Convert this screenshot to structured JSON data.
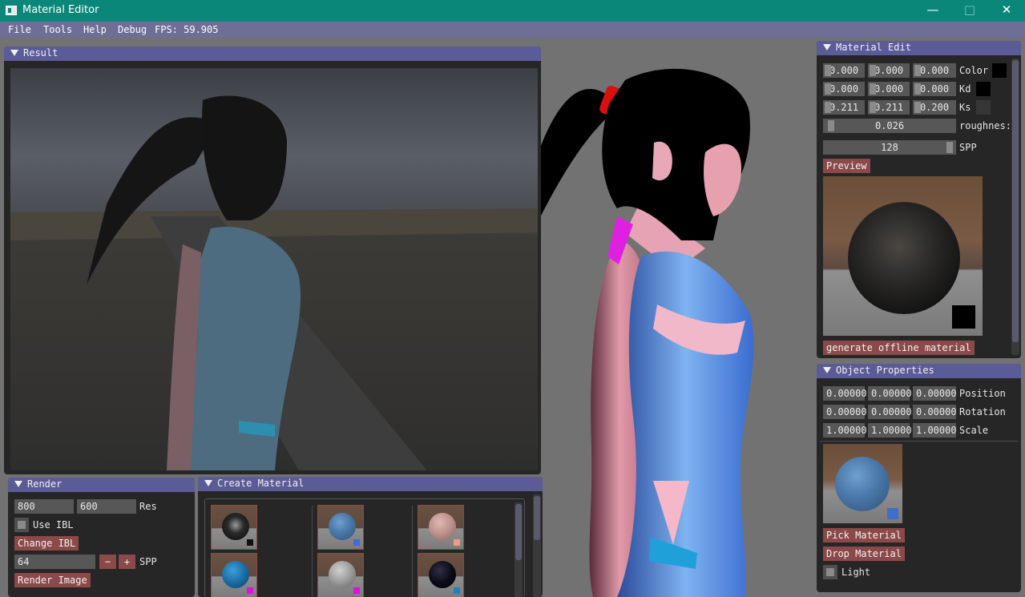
{
  "window": {
    "title": "Material Editor",
    "minimize": "—",
    "maximize": "□",
    "close": "✕"
  },
  "menu": {
    "file": "File",
    "tools": "Tools",
    "help": "Help",
    "debug": "Debug",
    "fps": "FPS: 59.905"
  },
  "result_panel": {
    "title": "Result"
  },
  "render_panel": {
    "title": "Render",
    "res_width": "800",
    "res_height": "600",
    "res_label": "Res",
    "use_ibl_label": "Use IBL",
    "change_ibl": "Change IBL",
    "spp_value": "64",
    "minus": "−",
    "plus": "+",
    "spp_label": "SPP",
    "render_image": "Render Image"
  },
  "create_material_panel": {
    "title": "Create Material",
    "thumbnails": [
      {
        "ball": "#1b1b1b",
        "chip": "#111111"
      },
      {
        "ball": "#4a78a8",
        "chip": "#3b6fd6"
      },
      {
        "ball": "#c0948f",
        "chip": "#f29a86"
      },
      {
        "ball": "#1c6da3",
        "chip": "#e010e0"
      },
      {
        "ball": "#9a9a9a",
        "chip": "#e010e0"
      },
      {
        "ball": "#0c0c18",
        "chip": "#2080c0"
      }
    ]
  },
  "material_edit": {
    "title": "Material Edit",
    "color": {
      "r": "0.000",
      "g": "0.000",
      "b": "0.000",
      "label": "Color",
      "swatch": "#000000"
    },
    "kd": {
      "r": "0.000",
      "g": "0.000",
      "b": "0.000",
      "label": "Kd",
      "swatch": "#000000"
    },
    "ks": {
      "r": "0.211",
      "g": "0.211",
      "b": "0.200",
      "label": "Ks",
      "swatch": "#363636"
    },
    "roughness": {
      "value": "0.026",
      "label": "roughnes:"
    },
    "spp": {
      "value": "128",
      "label": "SPP"
    },
    "preview_button": "Preview",
    "preview_swatch": "#000000",
    "generate_button": "generate offline material"
  },
  "object_properties": {
    "title": "Object Properties",
    "position": {
      "x": "0.00000",
      "y": "0.00000",
      "z": "0.00000",
      "label": "Position"
    },
    "rotation": {
      "x": "0.00000",
      "y": "0.00000",
      "z": "0.00000",
      "label": "Rotation"
    },
    "scale": {
      "x": "1.00000",
      "y": "1.00000",
      "z": "1.00000",
      "label": "Scale"
    },
    "material_swatch": "#3f6fc6",
    "pick_material": "Pick Material",
    "drop_material": "Drop Material",
    "light_label": "Light"
  }
}
